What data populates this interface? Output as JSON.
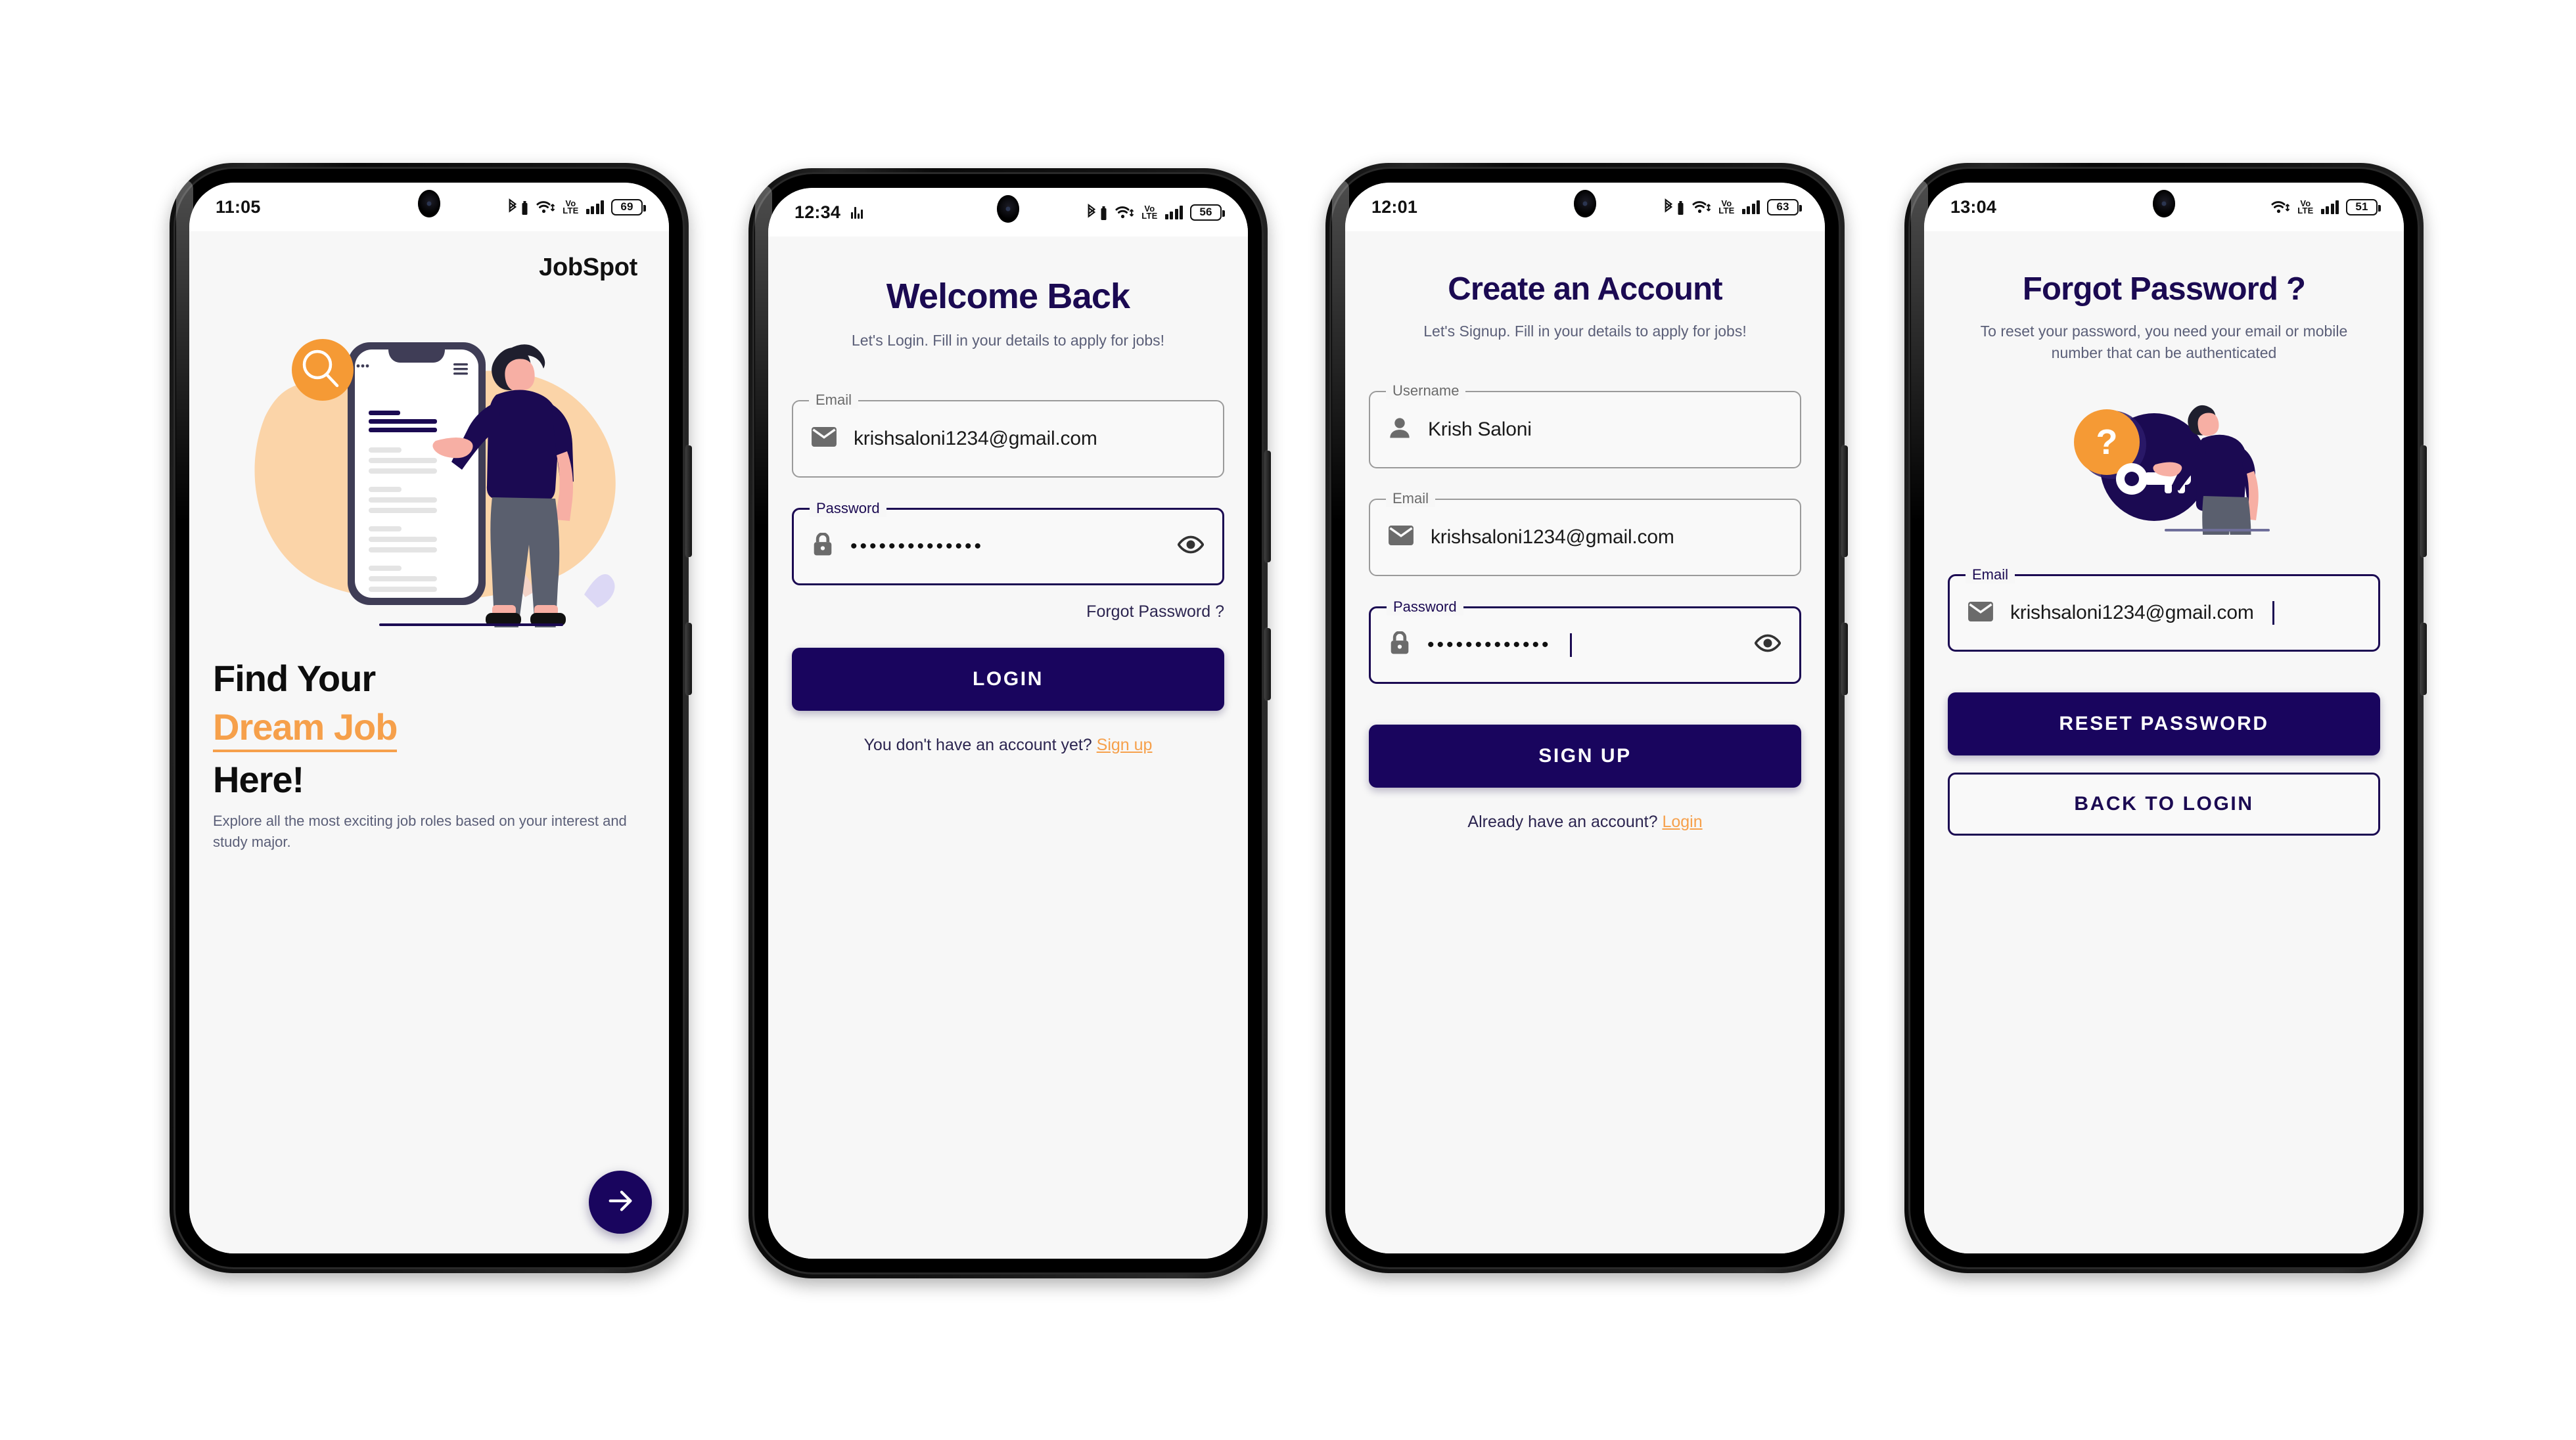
{
  "brand_color": "#19055e",
  "accent_color": "#F6A04B",
  "screens": [
    {
      "id": "onboarding",
      "status": {
        "time": "11:05",
        "bluetooth": true,
        "equalizer": false,
        "wifi": true,
        "volte": "VoLTE",
        "signal": "4 bars",
        "battery": "69"
      },
      "app_title": "JobSpot",
      "illustration": "job-search-illustration",
      "headline_line1": "Find Your",
      "headline_accent": "Dream Job",
      "headline_line3": "Here!",
      "subtitle": "Explore all the most exciting job roles based on your interest and study major.",
      "next_button": "arrow-right-icon"
    },
    {
      "id": "login",
      "status": {
        "time": "12:34",
        "bluetooth": true,
        "equalizer": true,
        "wifi": true,
        "volte": "VoLTE",
        "signal": "4 bars",
        "battery": "56"
      },
      "title": "Welcome Back",
      "tagline": "Let's Login. Fill in your details to apply for jobs!",
      "fields": [
        {
          "label": "Email",
          "icon": "envelope-icon",
          "value": "krishsaloni1234@gmail.com",
          "focused": false,
          "type": "text"
        },
        {
          "label": "Password",
          "icon": "lock-icon",
          "value": "••••••••••••••",
          "focused": true,
          "type": "password",
          "trailing_icon": "eye-icon"
        }
      ],
      "forgot_link": "Forgot Password ?",
      "primary_button": "LOGIN",
      "footnote_text": "You don't have an account yet?",
      "footnote_link": "Sign up"
    },
    {
      "id": "signup",
      "status": {
        "time": "12:01",
        "bluetooth": true,
        "equalizer": false,
        "wifi": true,
        "volte": "VoLTE",
        "signal": "4 bars",
        "battery": "63"
      },
      "title": "Create an Account",
      "tagline": "Let's Signup. Fill in your details to apply for jobs!",
      "fields": [
        {
          "label": "Username",
          "icon": "person-icon",
          "value": "Krish Saloni",
          "focused": false,
          "type": "text"
        },
        {
          "label": "Email",
          "icon": "envelope-icon",
          "value": "krishsaloni1234@gmail.com",
          "focused": false,
          "type": "text"
        },
        {
          "label": "Password",
          "icon": "lock-icon",
          "value": "•••••••••••••",
          "focused": true,
          "type": "password",
          "trailing_icon": "eye-icon"
        }
      ],
      "primary_button": "SIGN UP",
      "footnote_text": "Already have an account?",
      "footnote_link": "Login"
    },
    {
      "id": "forgot_password",
      "status": {
        "time": "13:04",
        "bluetooth": false,
        "equalizer": false,
        "wifi": true,
        "volte": "VoLTE",
        "signal": "4 bars",
        "battery": "51"
      },
      "title": "Forgot Password ?",
      "tagline": "To reset your password, you need your email or mobile number that can be authenticated",
      "illustration": "key-question-illustration",
      "fields": [
        {
          "label": "Email",
          "icon": "envelope-icon",
          "value": "krishsaloni1234@gmail.com",
          "focused": true,
          "type": "text"
        }
      ],
      "primary_button": "RESET PASSWORD",
      "secondary_button": "BACK TO LOGIN"
    }
  ]
}
